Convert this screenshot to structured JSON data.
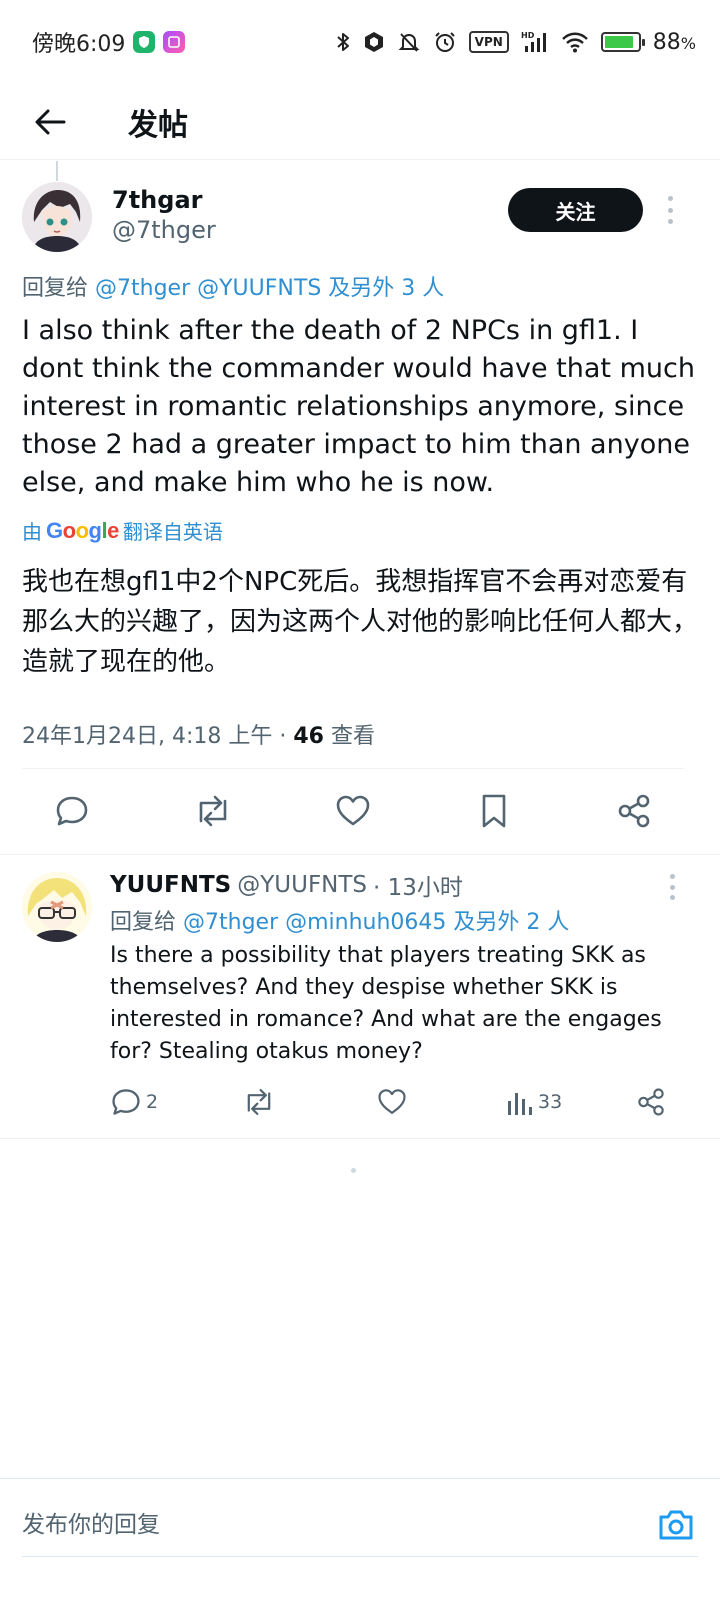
{
  "status_bar": {
    "time": "傍晚6:09",
    "vpn_label": "VPN",
    "hd_label": "HD",
    "battery_percent": "88",
    "battery_suffix": "%",
    "battery_level": 0.88
  },
  "app_bar": {
    "title": "发帖",
    "back_icon": "arrow-left-icon"
  },
  "main_tweet": {
    "display_name": "7thgar",
    "handle": "@7thger",
    "follow_label": "关注",
    "reply_prefix": "回复给",
    "reply_mentions": "@7thger @YUUFNTS 及另外 3 人",
    "text": "I also think after the death of 2 NPCs in gfl1. I dont think the commander would have that much interest in romantic relationships anymore, since those 2 had a greater impact to him than anyone else, and make him who he is now.",
    "translate_by": "由",
    "translate_provider": "Google",
    "translate_suffix": "翻译自英语",
    "translated_text": "我也在想gfl1中2个NPC死后。我想指挥官不会再对恋爱有那么大的兴趣了，因为这两个人对他的影响比任何人都大，造就了现在的他。",
    "timestamp": "24年1月24日, 4:18 上午 · ",
    "views": "46",
    "views_label": " 查看",
    "actions": [
      "reply-icon",
      "retweet-icon",
      "like-icon",
      "bookmark-icon",
      "share-icon"
    ]
  },
  "reply_tweet": {
    "display_name": "YUUFNTS",
    "handle": "@YUUFNTS",
    "time": "· 13小时",
    "reply_prefix": "回复给",
    "reply_mentions": "@7thger @minhuh0645 及另外 2 人",
    "text": "Is there a possibility that players treating SKK as themselves? And they despise whether SKK is interested in romance? And what are the engages for? Stealing otakus money?",
    "reply_count": "2",
    "views": "33"
  },
  "compose": {
    "placeholder": "发布你的回复"
  },
  "colors": {
    "accent": "#1d9bf0",
    "text_primary": "#0f1419",
    "text_secondary": "#536471",
    "follow_bg": "#0f1419"
  }
}
